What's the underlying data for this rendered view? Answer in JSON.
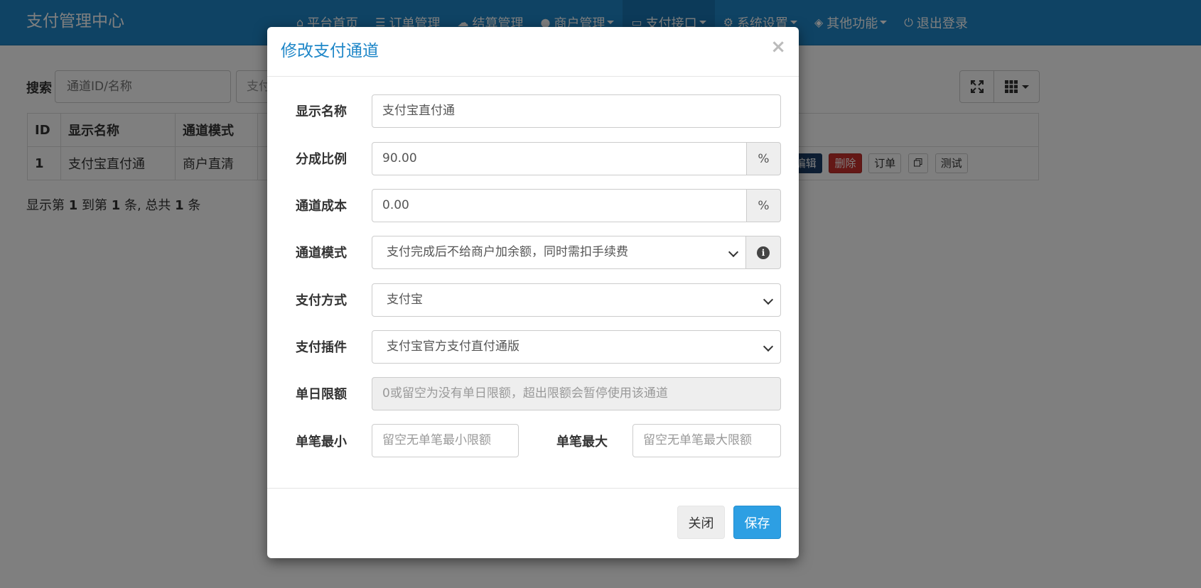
{
  "navbar": {
    "brand": "支付管理中心",
    "items": [
      {
        "icon": "home-icon",
        "glyph": "⌂",
        "label": "平台首页"
      },
      {
        "icon": "list-icon",
        "glyph": "☰",
        "label": "订单管理"
      },
      {
        "icon": "cloud-icon",
        "glyph": "☁",
        "label": "结算管理"
      },
      {
        "icon": "user-icon",
        "glyph": "●",
        "label": "商户管理",
        "dropdown": true
      },
      {
        "icon": "credit-card-icon",
        "glyph": "▭",
        "label": "支付接口",
        "dropdown": true,
        "active": true
      },
      {
        "icon": "gear-icon",
        "glyph": "⚙",
        "label": "系统设置",
        "dropdown": true
      },
      {
        "icon": "cube-icon",
        "glyph": "◈",
        "label": "其他功能",
        "dropdown": true
      },
      {
        "icon": "power-icon",
        "glyph": "⏻",
        "label": "退出登录"
      }
    ]
  },
  "search": {
    "label": "搜索",
    "placeholder": "通道ID/名称",
    "second_placeholder": "支付"
  },
  "table": {
    "headers": [
      "ID",
      "显示名称",
      "通道模式"
    ],
    "rows": [
      {
        "id": "1",
        "name": "支付宝直付通",
        "mode": "商户直清"
      }
    ],
    "actions": {
      "edit": "编辑",
      "delete": "删除",
      "order": "订单",
      "test": "测试"
    }
  },
  "pager": {
    "prefix": "显示第 ",
    "from": "1",
    "mid1": " 到第 ",
    "to": "1",
    "mid2": " 条, 总共 ",
    "total": "1",
    "suffix": " 条"
  },
  "modal": {
    "title": "修改支付通道",
    "close_glyph": "×",
    "fields": {
      "display_name": {
        "label": "显示名称",
        "value": "支付宝直付通"
      },
      "split_ratio": {
        "label": "分成比例",
        "value": "90.00",
        "addon": "%"
      },
      "channel_cost": {
        "label": "通道成本",
        "value": "0.00",
        "addon": "%"
      },
      "channel_mode": {
        "label": "通道模式",
        "value": "支付完成后不给商户加余额，同时需扣手续费"
      },
      "pay_method": {
        "label": "支付方式",
        "value": "支付宝"
      },
      "pay_plugin": {
        "label": "支付插件",
        "value": "支付宝官方支付直付通版"
      },
      "daily_limit": {
        "label": "单日限额",
        "placeholder": "0或留空为没有单日限额，超出限额会暂停使用该通道"
      },
      "min_amount": {
        "label": "单笔最小",
        "placeholder": "留空无单笔最小限额"
      },
      "max_amount": {
        "label": "单笔最大",
        "placeholder": "留空无单笔最大限额"
      }
    },
    "buttons": {
      "close": "关闭",
      "save": "保存"
    }
  }
}
